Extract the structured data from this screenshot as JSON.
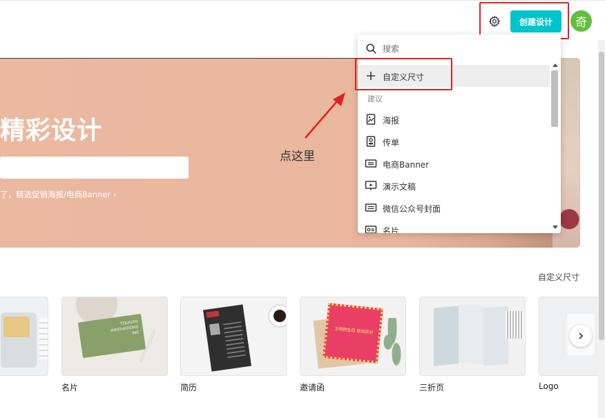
{
  "header": {
    "create_button_label": "创建设计",
    "avatar_initial": "奇"
  },
  "hero": {
    "title": "精彩设计",
    "subtitle": "了，精选促销海报/电商Banner ›"
  },
  "dropdown": {
    "search_placeholder": "搜索",
    "custom_size_label": "自定义尺寸",
    "section_label": "建议",
    "items": [
      {
        "label": "海报",
        "icon": "poster-icon"
      },
      {
        "label": "传单",
        "icon": "flyer-icon"
      },
      {
        "label": "电商Banner",
        "icon": "banner-icon"
      },
      {
        "label": "演示文稿",
        "icon": "presentation-icon"
      },
      {
        "label": "微信公众号封面",
        "icon": "wechat-cover-icon"
      },
      {
        "label": "名片",
        "icon": "business-card-icon"
      }
    ]
  },
  "annotation": {
    "text": "点这里"
  },
  "templates": {
    "custom_size_link": "自定义尺寸",
    "cards": [
      {
        "label": "名片"
      },
      {
        "label": "简历"
      },
      {
        "label": "邀请函"
      },
      {
        "label": "三折页"
      },
      {
        "label": "Logo"
      }
    ],
    "card_art": {
      "business_card_text": "TOUGAN INNOVATIONS INC",
      "invitation_text": "王明的生日 移动派对"
    }
  },
  "colors": {
    "accent": "#00c4cc",
    "avatar": "#5fbf3a",
    "highlight_box": "#e02020",
    "hero_background": "#ebb9a0"
  }
}
